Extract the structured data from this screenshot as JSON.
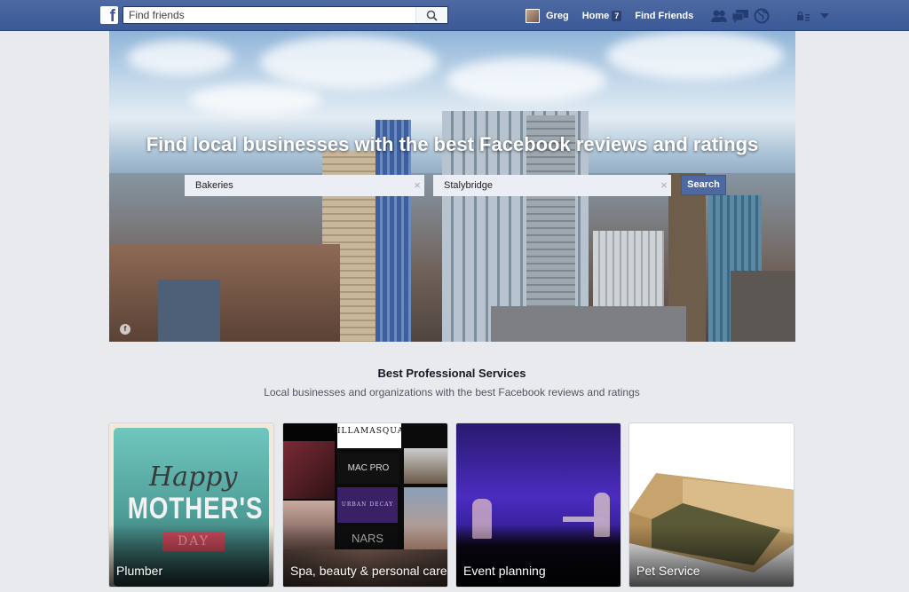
{
  "topbar": {
    "logo": "f",
    "search_placeholder": "Find friends",
    "user_name": "Greg",
    "home_label": "Home",
    "home_badge": "7",
    "find_friends_label": "Find Friends",
    "icons": [
      "friend-requests-icon",
      "messages-icon",
      "notifications-globe-icon",
      "privacy-shortcuts-icon",
      "account-menu-chevron-icon"
    ]
  },
  "hero": {
    "title": "Find local businesses with the best Facebook reviews and ratings",
    "category_value": "Bakeries",
    "location_value": "Stalybridge",
    "clear_glyph": "×",
    "search_button": "Search"
  },
  "section": {
    "title": "Best Professional Services",
    "subtitle": "Local businesses and organizations with the best Facebook reviews and ratings"
  },
  "cards": [
    {
      "label": "Plumber",
      "image_text": {
        "script": "Happy",
        "main": "MOTHER'S",
        "ribbon": "DAY"
      }
    },
    {
      "label": "Spa, beauty & personal care",
      "image_text": {
        "brand1": "ILLAMASQUA",
        "brand2": "MAC PRO",
        "brand3": "URBAN DECAY",
        "brand4": "NARS"
      }
    },
    {
      "label": "Event planning"
    },
    {
      "label": "Pet Service"
    }
  ],
  "colors": {
    "brand_blue": "#3b5998",
    "page_bg": "#e9eaed",
    "teal_card": "#6cc4bb",
    "event_purple": "#3a1f8f"
  }
}
